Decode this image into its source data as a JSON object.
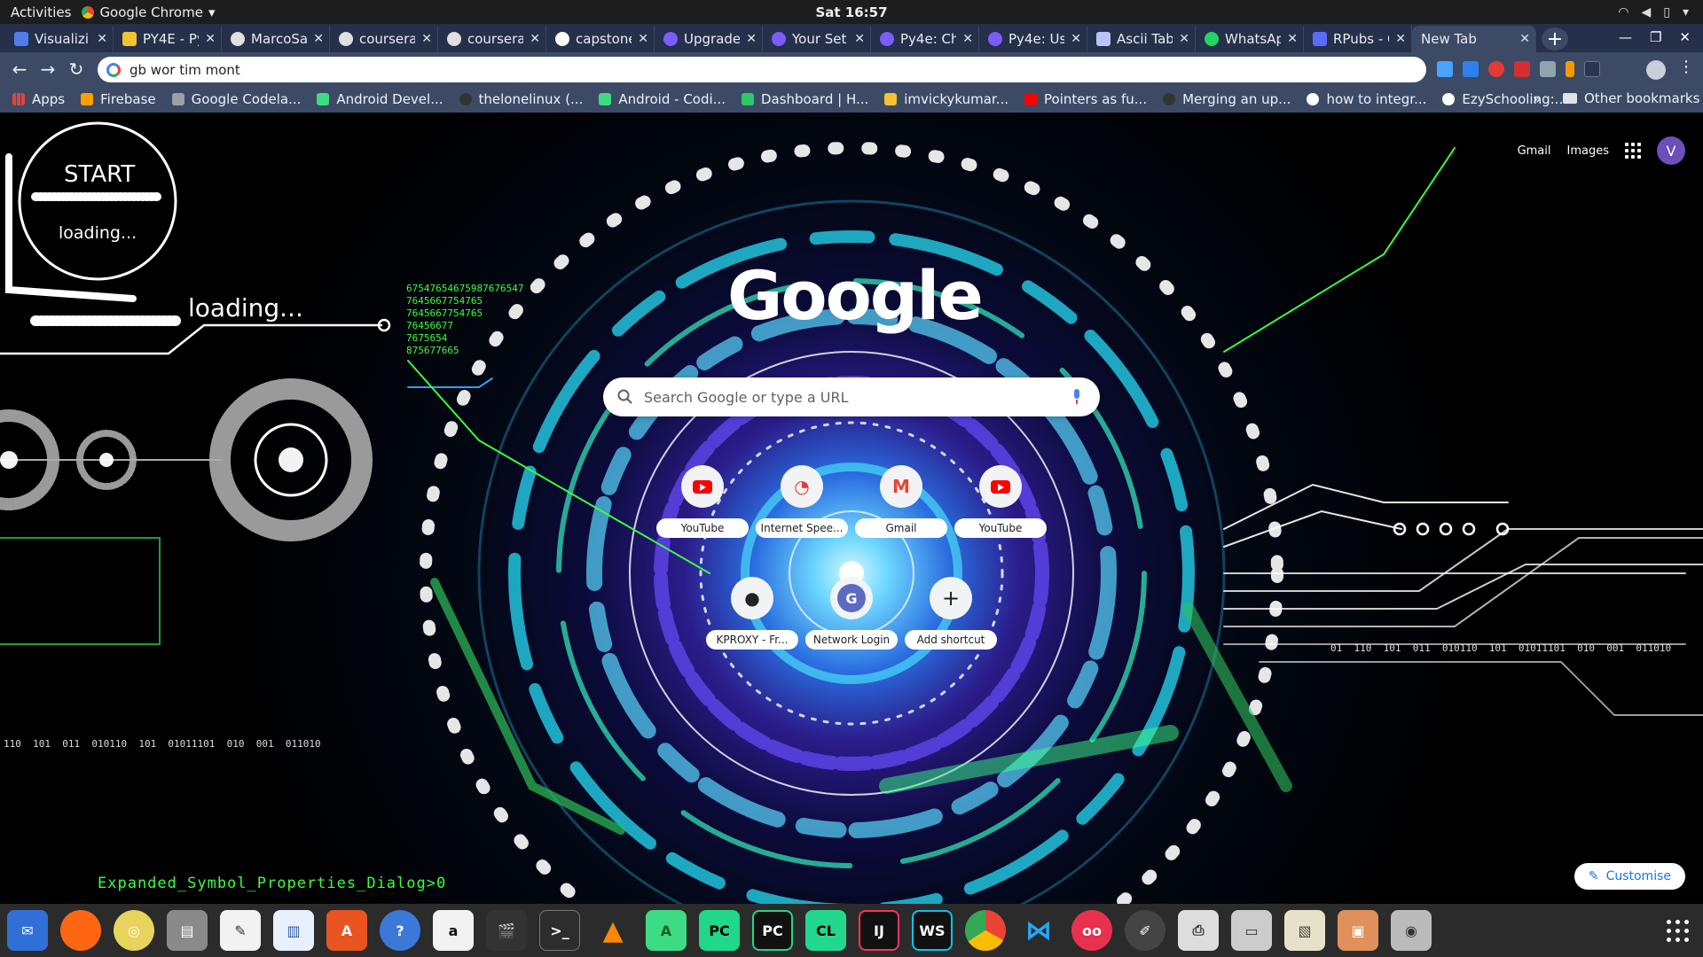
{
  "topbar": {
    "activities": "Activities",
    "app_name": "Google Chrome",
    "clock": "Sat 16:57"
  },
  "tabs": [
    {
      "title": "Visualizi",
      "color": "#4f7df0"
    },
    {
      "title": "PY4E - Py",
      "color": "#f2c230"
    },
    {
      "title": "MarcoSa",
      "color": "#e0e0e0"
    },
    {
      "title": "coursera",
      "color": "#e0e0e0"
    },
    {
      "title": "coursera",
      "color": "#e0e0e0"
    },
    {
      "title": "capstone",
      "color": "#ffffff"
    },
    {
      "title": "Upgrade",
      "color": "#7b5cff"
    },
    {
      "title": "Your Set",
      "color": "#7b5cff"
    },
    {
      "title": "Py4e: Ch",
      "color": "#7b5cff"
    },
    {
      "title": "Py4e: Us",
      "color": "#7b5cff"
    },
    {
      "title": "Ascii Tab",
      "color": "#b9c4ff"
    },
    {
      "title": "WhatsAp",
      "color": "#25d366"
    },
    {
      "title": "RPubs - C",
      "color": "#5a6cff"
    },
    {
      "title": "New Tab",
      "color": "",
      "active": true
    }
  ],
  "omnibox": {
    "value": "gb wor tim mont"
  },
  "bookmarks": {
    "items": [
      {
        "label": "Apps",
        "color": "#e94235"
      },
      {
        "label": "Firebase",
        "color": "#ffa000"
      },
      {
        "label": "Google Codela...",
        "color": "#9aa0a6"
      },
      {
        "label": "Android Devel...",
        "color": "#3ddc84"
      },
      {
        "label": "thelonelinux (...",
        "color": "#333333"
      },
      {
        "label": "Android - Codi...",
        "color": "#3ddc84"
      },
      {
        "label": "Dashboard | H...",
        "color": "#2ec866"
      },
      {
        "label": "imvickykumar...",
        "color": "#f2c230"
      },
      {
        "label": "Pointers as fu...",
        "color": "#ff0000"
      },
      {
        "label": "Merging an up...",
        "color": "#333333"
      },
      {
        "label": "how to integr...",
        "color": "#ffffff"
      },
      {
        "label": "EzySchooling:...",
        "color": "#ffffff"
      }
    ],
    "more": "»",
    "other": "Other bookmarks"
  },
  "gbar": {
    "gmail": "Gmail",
    "images": "Images",
    "avatar": "V"
  },
  "logo": "Google",
  "search": {
    "placeholder": "Search Google or type a URL"
  },
  "shortcuts": [
    {
      "label": "YouTube",
      "icon": "youtube-icon"
    },
    {
      "label": "Internet Spee...",
      "icon": "speedometer-icon"
    },
    {
      "label": "Gmail",
      "icon": "gmail-icon"
    },
    {
      "label": "YouTube",
      "icon": "youtube-icon"
    },
    {
      "label": "KPROXY - Fr...",
      "icon": "kproxy-icon"
    },
    {
      "label": "Network Login",
      "icon": "g-letter-icon"
    },
    {
      "label": "Add shortcut",
      "icon": "plus-icon"
    }
  ],
  "customise": "Customise",
  "wallpaper": {
    "start": "START",
    "loading_inner": "loading...",
    "loading_outer": "loading...",
    "numbers": [
      "67547654675987676547",
      "7645667754765",
      "7645667754765",
      "76456677",
      "7675654",
      "875677665"
    ],
    "binary_right": "01  110  101  011  010110  101  01011101  010  001  011010",
    "binary_left": "110  101  011  010110  101  01011101  010  001  011010",
    "console": "Expanded_Symbol_Properties_Dialog>0"
  },
  "dock": [
    "thunderbird",
    "firefox",
    "rhythmbox",
    "files",
    "text-editor",
    "libreoffice-writer",
    "software",
    "help",
    "amazon",
    "video-editor",
    "terminal",
    "vlc",
    "android-studio",
    "pycharm",
    "pycharm-pro",
    "clion",
    "intellij",
    "webstorm",
    "chrome",
    "vscode",
    "flickr",
    "color-picker",
    "printer",
    "scanner",
    "image-viewer",
    "archive",
    "screenshot"
  ]
}
